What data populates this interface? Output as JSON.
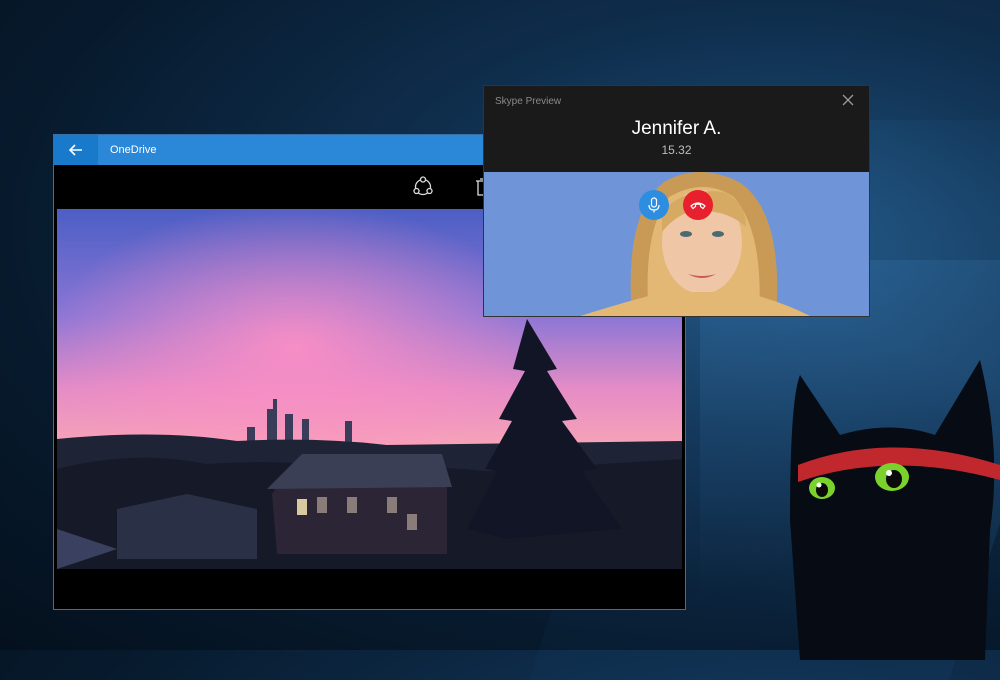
{
  "onedrive": {
    "title": "OneDrive",
    "icons": {
      "back": "back-arrow-icon",
      "share": "share-icon",
      "delete": "delete-icon"
    }
  },
  "skype": {
    "window_title": "Skype Preview",
    "caller_name": "Jennifer A.",
    "call_duration": "15.32",
    "icons": {
      "close": "close-icon",
      "mic": "microphone-icon",
      "end_call": "end-call-icon"
    },
    "colors": {
      "mic_button": "#2d8de0",
      "end_call_button": "#e81f2d"
    }
  },
  "colors": {
    "onedrive_titlebar": "#2b88d8",
    "desktop_background": "#0f2e4d"
  }
}
